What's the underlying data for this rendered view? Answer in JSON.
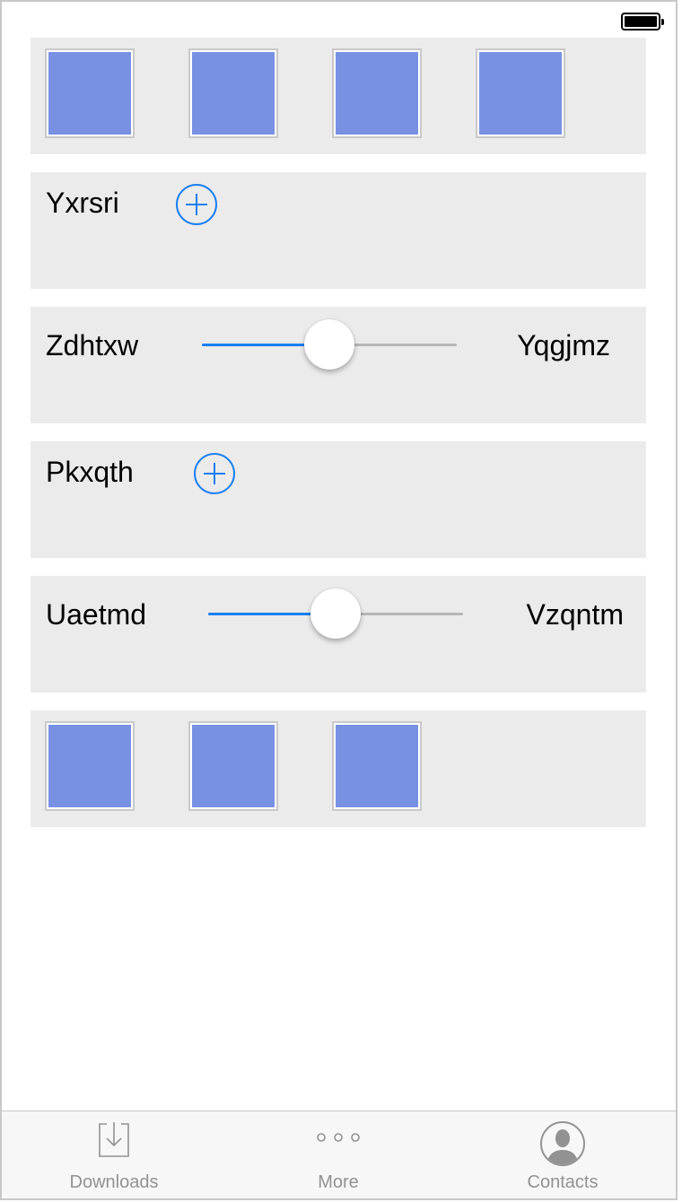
{
  "status_bar": {
    "battery_icon": "battery-full-icon"
  },
  "panels": [
    {
      "type": "squares",
      "count": 4
    },
    {
      "type": "add",
      "label": "Yxrsri",
      "icon": "plus-circle-icon"
    },
    {
      "type": "slider",
      "left_label": "Zdhtxw",
      "right_label": "Yqgjmz",
      "value": 0.5
    },
    {
      "type": "add",
      "label": "Pkxqth",
      "icon": "plus-circle-icon"
    },
    {
      "type": "slider",
      "left_label": "Uaetmd",
      "right_label": "Vzqntm",
      "value": 0.5
    },
    {
      "type": "squares",
      "count": 3
    }
  ],
  "tabs": [
    {
      "label": "Downloads",
      "icon": "downloads-icon"
    },
    {
      "label": "More",
      "icon": "more-icon"
    },
    {
      "label": "Contacts",
      "icon": "contacts-icon"
    }
  ],
  "colors": {
    "accent": "#1a7ff1",
    "square_fill": "#7891e3",
    "panel_bg": "#ebebeb",
    "tab_label": "#929292"
  }
}
